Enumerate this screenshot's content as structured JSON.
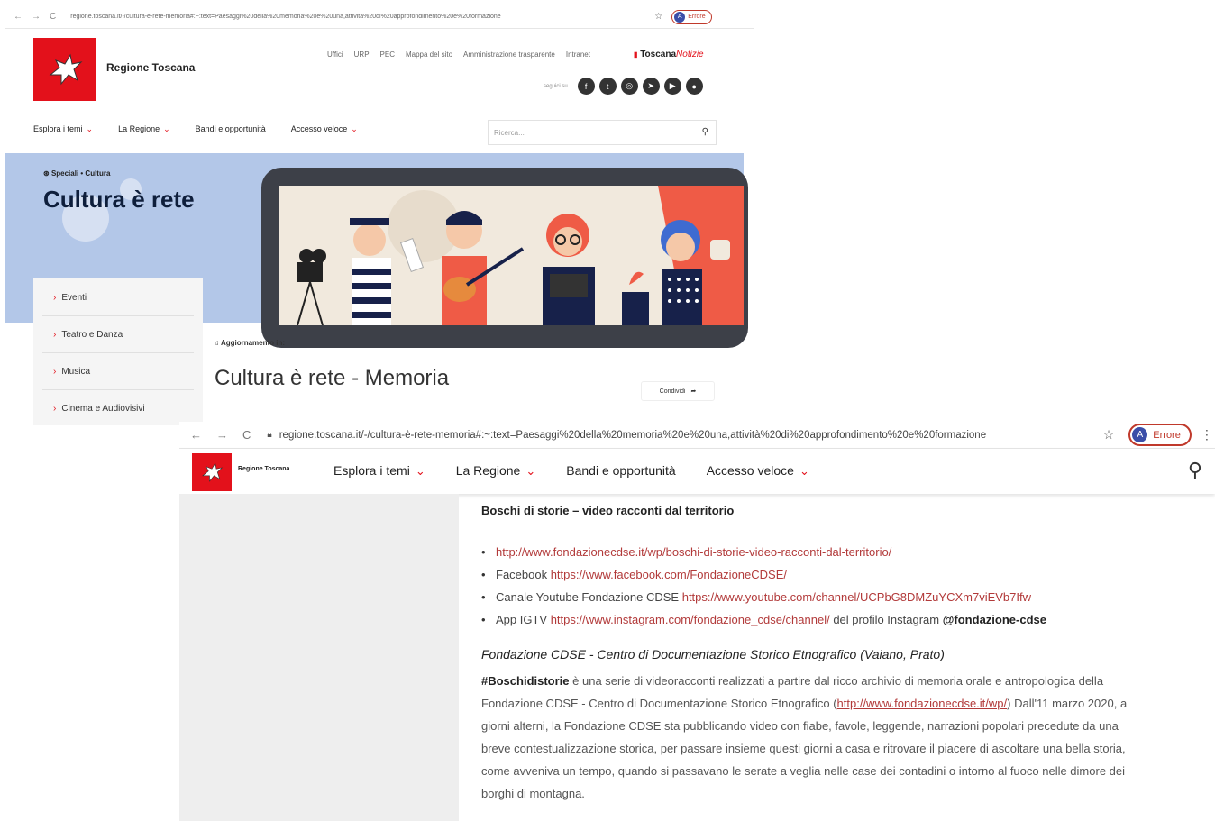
{
  "shot1": {
    "browser": {
      "url": "regione.toscana.it/-/cultura-e-rete-memoria#:~:text=Paesaggi%20della%20memoria%20e%20una,attivita%20di%20approfondimento%20e%20formazione",
      "profile_initial": "A",
      "profile_label": "Errore"
    },
    "brand": "Regione Toscana",
    "topnav": [
      "Uffici",
      "URP",
      "PEC",
      "Mappa del sito",
      "Amministrazione trasparente",
      "Intranet"
    ],
    "toscana_notizie": {
      "part1": "Toscana",
      "part2": "Notizie"
    },
    "social_label": "seguici su",
    "mainnav": [
      "Esplora i temi",
      "La Regione",
      "Bandi e opportunità",
      "Accesso veloce"
    ],
    "search_placeholder": "Ricerca...",
    "breadcrumb": "Speciali • Cultura",
    "hero_title": "Cultura è rete",
    "side_menu": [
      "Eventi",
      "Teatro e Danza",
      "Musica",
      "Cinema e Audiovisivi"
    ],
    "update_label": "Aggiornamento in:",
    "page_title": "Cultura è rete - Memoria",
    "share_label": "Condividi"
  },
  "shot2": {
    "browser": {
      "url": "regione.toscana.it/-/cultura-è-rete-memoria#:~:text=Paesaggi%20della%20memoria%20e%20una,attività%20di%20approfondimento%20e%20formazione",
      "profile_initial": "A",
      "profile_label": "Errore"
    },
    "brand": "Regione Toscana",
    "mainnav": [
      "Esplora i temi",
      "La Regione",
      "Bandi e opportunità",
      "Accesso veloce"
    ],
    "section_title": "Boschi di storie – video racconti dal territorio",
    "bullets": [
      {
        "prefix": "",
        "link": "http://www.fondazionecdse.it/wp/boschi-di-storie-video-racconti-dal-territorio/",
        "suffix": "",
        "handle": ""
      },
      {
        "prefix": "Facebook ",
        "link": "https://www.facebook.com/FondazioneCDSE/",
        "suffix": "",
        "handle": ""
      },
      {
        "prefix": "Canale Youtube Fondazione CDSE ",
        "link": "https://www.youtube.com/channel/UCPbG8DMZuYCXm7viEVb7Ifw",
        "suffix": "",
        "handle": ""
      },
      {
        "prefix": "App IGTV ",
        "link": "https://www.instagram.com/fondazione_cdse/channel/",
        "suffix": " del profilo Instagram ",
        "handle": "@fondazione-cdse"
      }
    ],
    "org_title": "Fondazione CDSE - Centro di Documentazione Storico Etnografico (Vaiano, Prato)",
    "para": {
      "hashtag": "#Boschidistorie",
      "text1": " è una serie di videoracconti realizzati a partire dal ricco archivio di memoria orale e antropologica della Fondazione CDSE - Centro di Documentazione Storico Etnografico (",
      "link": "http://www.fondazionecdse.it/wp/",
      "text2": ") Dall'11 marzo 2020, a giorni alterni, la Fondazione CDSE sta pubblicando video con fiabe, favole, leggende, narrazioni popolari precedute da una    breve contestualizzazione storica, per passare insieme questi giorni a casa e ritrovare il piacere di ascoltare una bella storia, come avveniva un tempo, quando si passavano le serate a veglia nelle case dei contadini o intorno al fuoco nelle dimore dei borghi di montagna."
    }
  },
  "colors": {
    "brand_red": "#e3111b",
    "hero_blue": "#b3c7e8",
    "link": "#b23a3a"
  }
}
